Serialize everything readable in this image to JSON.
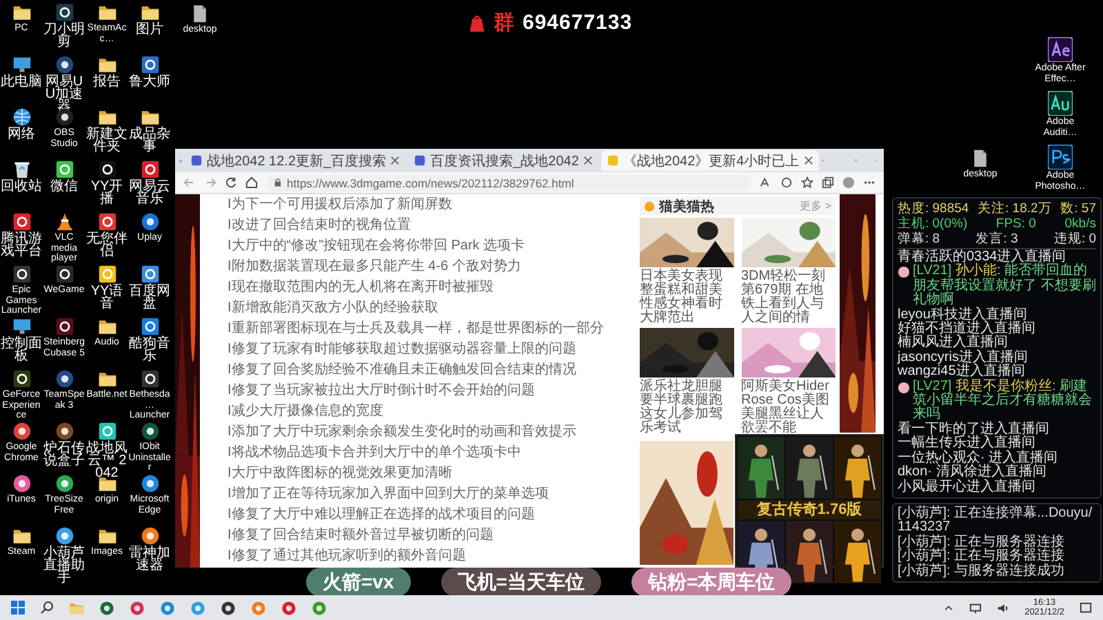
{
  "qq_group": {
    "label": "群",
    "number": "694677133"
  },
  "desktop_icons": [
    {
      "label": "PC"
    },
    {
      "label": "刀小明剪"
    },
    {
      "label": "SteamAcc…"
    },
    {
      "label": "图片"
    },
    {
      "label": "此电脑"
    },
    {
      "label": "网易UU加速器"
    },
    {
      "label": "报告"
    },
    {
      "label": "鲁大师"
    },
    {
      "label": "网络"
    },
    {
      "label": "OBS Studio"
    },
    {
      "label": "新建文件夹"
    },
    {
      "label": "成品杂事"
    },
    {
      "label": "回收站"
    },
    {
      "label": "微信"
    },
    {
      "label": "YY开播"
    },
    {
      "label": "网易云音乐"
    },
    {
      "label": "腾讯游戏平台"
    },
    {
      "label": "VLC media player"
    },
    {
      "label": "无您伴侣"
    },
    {
      "label": "Uplay"
    },
    {
      "label": "Epic Games Launcher"
    },
    {
      "label": "WeGame"
    },
    {
      "label": "YY语音"
    },
    {
      "label": "百度网盘"
    },
    {
      "label": "控制面板"
    },
    {
      "label": "Steinberg Cubase 5"
    },
    {
      "label": "Audio"
    },
    {
      "label": "酷狗音乐"
    },
    {
      "label": "GeForce Experience"
    },
    {
      "label": "TeamSpeak 3"
    },
    {
      "label": "Battle.net"
    },
    {
      "label": "Bethesda… Launcher"
    },
    {
      "label": "Google Chrome"
    },
    {
      "label": "炉石传说盒子"
    },
    {
      "label": "战地风云™ 2042"
    },
    {
      "label": "IObit Uninstaller"
    },
    {
      "label": "iTunes"
    },
    {
      "label": "TreeSize Free"
    },
    {
      "label": "origin"
    },
    {
      "label": "Microsoft Edge"
    },
    {
      "label": "Steam"
    },
    {
      "label": "小葫芦直播助手"
    },
    {
      "label": "Images"
    },
    {
      "label": "雷神加速器"
    }
  ],
  "desktop_file": {
    "label": "desktop"
  },
  "desktop_file_right": {
    "label": "desktop"
  },
  "adobe_icons": [
    {
      "label": "Adobe After Effec…"
    },
    {
      "label": "Adobe Auditi…"
    },
    {
      "label": "Adobe Photosho…"
    }
  ],
  "browser": {
    "tabs": [
      {
        "title": "战地2042 12.2更新_百度搜索",
        "selected": false
      },
      {
        "title": "百度资讯搜索_战地2042",
        "selected": false
      },
      {
        "title": "《战地2042》更新4小时已上",
        "selected": true
      }
    ],
    "url": "https://www.3dmgame.com/news/202112/3829762.html",
    "article_lines": [
      "I为下一个可用援权后添加了新闻屏数",
      "I改进了回合结束时的视角位置",
      "I大厅中的“修改”按钮现在会将你带回 Park 选项卡",
      "I附加数据装置现在最多只能产生 4-6 个敌对势力",
      "I现在撤取范围内的无人机将在离开时被摧毁",
      "I新增敌能消灭敌方小队的经验获取",
      "I重新部署图标现在与士兵及载具一样，都是世界图标的一部分",
      "I修复了玩家有时能够获取超过数据驱动器容量上限的问题",
      "I修复了回合奖励经验不准确且未正确触发回合结束的情况",
      "I修复了当玩家被拉出大厅时倒计时不会开始的问题",
      "I减少大厅摄像信息的宽度",
      "I添加了大厅中玩家剩余余额发生变化时的动画和音效提示",
      "I将战术物品选项卡合并到大厅中的单个选项卡中",
      "I大厅中敌阵图标的视觉效果更加清晰",
      "I增加了正在等待玩家加入界面中回到大厅的菜单选项",
      "I修复了大厅中难以理解正在选择的战术项目的问题",
      "I修复了回合结束时额外音过早被切断的问题",
      "I修复了通过其他玩家听到的额外音问题"
    ],
    "sidebar": {
      "title": "猫美猫热",
      "more": "更多 >",
      "items": [
        {
          "caption": "日本美女表现整蛋糕和甜美性感女神看时大牌范出"
        },
        {
          "caption": "3DM轻松一刻第679期 在地铁上看到人与人之间的情"
        },
        {
          "caption": "派乐社龙胆腿要半球裹腿跑这女儿参加驾乐考试"
        },
        {
          "caption": "阿斯美女HiderRose Cos美图美腿黑丝让人欲罢不能"
        }
      ]
    },
    "ad": {
      "title": "复古传奇1.76版"
    }
  },
  "chat": {
    "stats": [
      {
        "cells": [
          "热度: 98854",
          "关注: 18.2万",
          "数: 57"
        ]
      },
      {
        "cells": [
          "主机: 0(0%)",
          "FPS: 0",
          "0kb/s"
        ]
      },
      {
        "cells": [
          "弹幕: 8",
          "发言: 3",
          "违规: 0"
        ]
      }
    ],
    "messages": [
      {
        "kind": "enter",
        "text": "青春活跃的0334进入直播间"
      },
      {
        "kind": "chat",
        "badge": "[LV21]",
        "user": "孙小能:",
        "text": "能否带回血的朋友帮我设置就好了 不想要刷礼物啊"
      },
      {
        "kind": "enter",
        "text": "leyou科技进入直播间"
      },
      {
        "kind": "enter",
        "text": "好猫不挡道进入直播间"
      },
      {
        "kind": "enter",
        "text": "楠风风进入直播间"
      },
      {
        "kind": "enter",
        "text": "jasoncyris进入直播间"
      },
      {
        "kind": "enter",
        "text": "wangzi45进入直播间"
      },
      {
        "kind": "chat",
        "badge": "[LV27]",
        "user": "我是不是你粉丝:",
        "text": "刷建筑小留半年之后才有糖糖就会来吗"
      },
      {
        "kind": "enter",
        "text": "看一下昨的了进入直播间"
      },
      {
        "kind": "enter",
        "text": "一幅生传乐进入直播间"
      },
      {
        "kind": "enter",
        "text": "一位热心观众· 进入直播间"
      },
      {
        "kind": "enter",
        "text": "dkon· 清风徐进入直播间"
      },
      {
        "kind": "enter",
        "text": "小风最开心进入直播间"
      }
    ],
    "log": [
      "[小葫芦]: 正在连接弹幕...Douyu/1143237",
      "[小葫芦]: 正在与服务器连接",
      "[小葫芦]: 正在与服务器连接",
      "[小葫芦]: 与服务器连接成功"
    ]
  },
  "promos": [
    {
      "label": "火箭=vx",
      "color": "#4f7e6c"
    },
    {
      "label": "飞机=当天车位",
      "color": "#5b4b4a"
    },
    {
      "label": "钻粉=本周车位",
      "color": "#c4819f"
    }
  ],
  "taskbar": {
    "time": "16:13",
    "date": "2021/12/2"
  }
}
